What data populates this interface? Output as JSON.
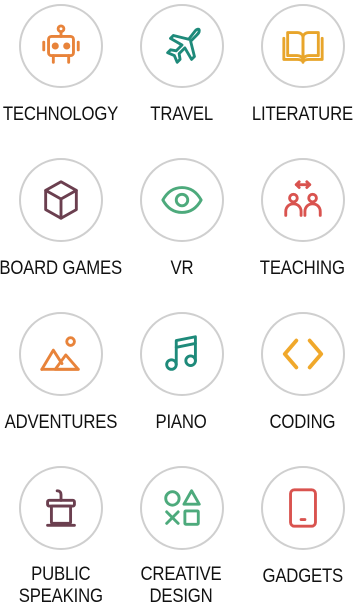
{
  "interests": [
    {
      "label": "TECHNOLOGY",
      "icon": "robot-icon",
      "color": "#E8833A"
    },
    {
      "label": "TRAVEL",
      "icon": "airplane-icon",
      "color": "#1E8A7A"
    },
    {
      "label": "LITERATURE",
      "icon": "open-book-icon",
      "color": "#E8A52B"
    },
    {
      "label": "BOARD GAMES",
      "icon": "cube-icon",
      "color": "#6B3F4F"
    },
    {
      "label": "VR",
      "icon": "eye-icon",
      "color": "#4DAA7C"
    },
    {
      "label": "TEACHING",
      "icon": "people-exchange-icon",
      "color": "#D9534F"
    },
    {
      "label": "ADVENTURES",
      "icon": "mountains-sun-icon",
      "color": "#E8833A"
    },
    {
      "label": "PIANO",
      "icon": "music-note-icon",
      "color": "#1E8A7A"
    },
    {
      "label": "CODING",
      "icon": "code-brackets-icon",
      "color": "#F0A82B"
    },
    {
      "label": "PUBLIC",
      "label2": "SPEAKING",
      "icon": "podium-icon",
      "color": "#6B3F4F"
    },
    {
      "label": "CREATIVE",
      "label2": "DESIGN",
      "icon": "shapes-icon",
      "color": "#4DAA7C"
    },
    {
      "label": "GADGETS",
      "icon": "tablet-icon",
      "color": "#D9534F"
    }
  ]
}
